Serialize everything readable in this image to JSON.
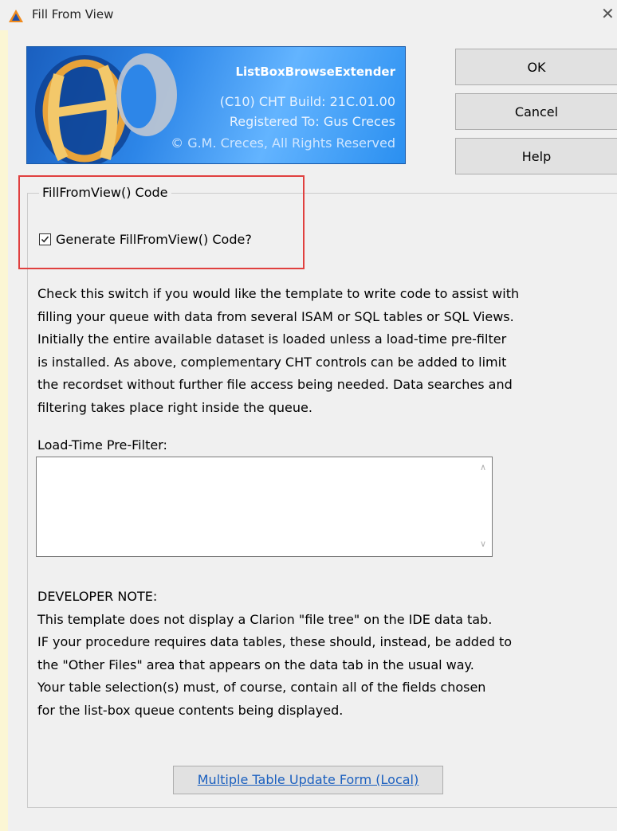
{
  "window": {
    "title": "Fill From View",
    "close_glyph": "✕"
  },
  "banner": {
    "product_name": "ListBoxBrowseExtender",
    "build": "(C10) CHT Build: 21C.01.00",
    "registered": "Registered To: Gus Creces",
    "copyright": "© G.M. Creces, All Rights Reserved"
  },
  "buttons": {
    "ok": "OK",
    "cancel": "Cancel",
    "help": "Help"
  },
  "group": {
    "label": "FillFromView() Code",
    "checkbox_label": "Generate FillFromView() Code?",
    "checkbox_checked": true
  },
  "description": [
    "Check this switch if you would like the template to write code to assist with",
    "filling your queue with data from several ISAM or SQL tables or SQL Views.",
    "Initially the entire available dataset is loaded unless a load-time pre-filter",
    "is installed. As above, complementary CHT controls can be added to limit",
    "the recordset without further file access being needed. Data searches and",
    "filtering takes place right inside the queue."
  ],
  "prefilter": {
    "label": "Load-Time Pre-Filter:",
    "value": ""
  },
  "note": [
    "DEVELOPER NOTE:",
    "This template does not display a Clarion \"file tree\" on the IDE data tab.",
    "IF your procedure requires data tables, these should, instead, be added to",
    "the \"Other Files\" area that appears on the data tab in the usual way.",
    "Your table selection(s) must, of course, contain all of the fields chosen",
    "for the list-box queue contents being displayed."
  ],
  "link_button": "Multiple Table Update Form (Local)",
  "colors": {
    "highlight_box": "#e0403f",
    "link": "#1a5fbf",
    "banner_blue": "#2d86e8"
  },
  "icons": {
    "app": "clarion-triangle-icon",
    "close": "close-icon",
    "check": "checkmark-icon"
  }
}
